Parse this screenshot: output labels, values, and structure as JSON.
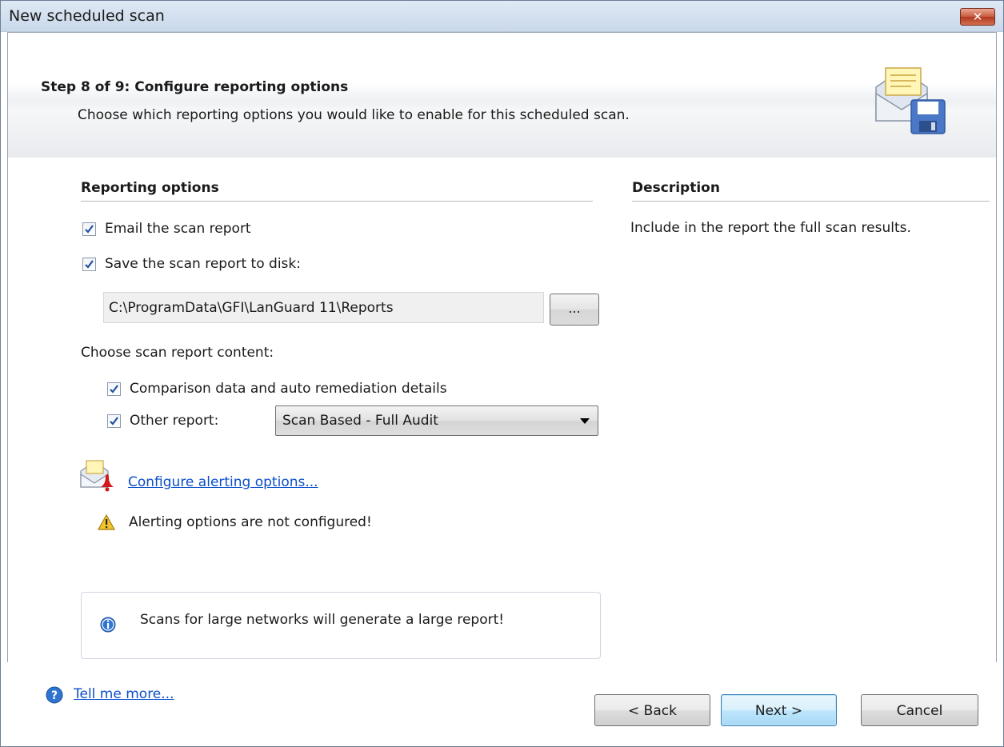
{
  "window": {
    "title": "New scheduled scan",
    "close_label": "✕"
  },
  "header": {
    "step_title": "Step 8 of 9: Configure reporting options",
    "step_subtitle": "Choose which reporting options you would like to enable for this scheduled scan.",
    "icon": "mail-save-icon"
  },
  "reporting": {
    "section_title": "Reporting options",
    "email_label": "Email the scan report",
    "email_checked": true,
    "save_label": "Save the scan report to disk:",
    "save_checked": true,
    "path_value": "C:\\ProgramData\\GFI\\LanGuard 11\\Reports",
    "browse_label": "...",
    "content_label": "Choose scan report content:",
    "comparison_label": "Comparison data and auto remediation details",
    "comparison_checked": true,
    "other_label": "Other report:",
    "other_checked": true,
    "other_selected": "Scan Based - Full Audit",
    "alerting_link": "Configure alerting options...",
    "alerting_warning": "Alerting options are not configured!",
    "info_text": "Scans for large networks will generate a large report!"
  },
  "description": {
    "section_title": "Description",
    "text": "Include in the report the full scan results."
  },
  "footer": {
    "help_link": "Tell me more...",
    "back_label": "< Back",
    "next_label": "Next >",
    "cancel_label": "Cancel"
  },
  "colors": {
    "link": "#0a4ec9",
    "close_button": "#c75a3e",
    "default_button_border": "#3c7fb1"
  }
}
